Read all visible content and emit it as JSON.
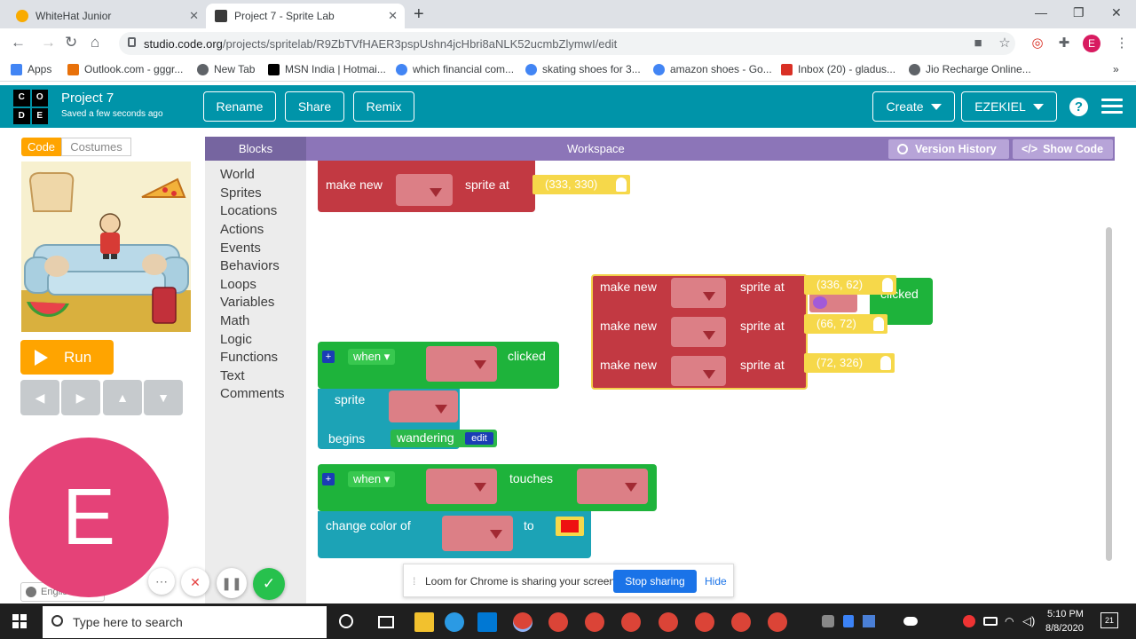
{
  "browser": {
    "tabs": [
      {
        "title": "WhiteHat Junior"
      },
      {
        "title": "Project 7 - Sprite Lab"
      }
    ],
    "url_host": "studio.code.org",
    "url_path": "/projects/spritelab/R9ZbTVfHAER3pspUshn4jcHbri8aNLK52ucmbZlymwI/edit",
    "profile_initial": "E",
    "bookmarks": [
      {
        "label": "Apps",
        "color": "#4285f4"
      },
      {
        "label": "Outlook.com - gggr...",
        "color": "#e8710a"
      },
      {
        "label": "New Tab",
        "color": "#5f6368"
      },
      {
        "label": "MSN India | Hotmai...",
        "color": "#000000"
      },
      {
        "label": "which financial com...",
        "color": "#4285f4"
      },
      {
        "label": "skating shoes for 3...",
        "color": "#4285f4"
      },
      {
        "label": "amazon shoes - Go...",
        "color": "#4285f4"
      },
      {
        "label": "Inbox (20) - gladus...",
        "color": "#d93025"
      },
      {
        "label": "Jio Recharge Online...",
        "color": "#5f6368"
      }
    ]
  },
  "app": {
    "logo_letters": [
      "C",
      "O",
      "D",
      "E"
    ],
    "project_title": "Project 7",
    "save_status": "Saved a few seconds ago",
    "rename_label": "Rename",
    "share_label": "Share",
    "remix_label": "Remix",
    "create_label": "Create",
    "user_label": "EZEKIEL",
    "help_label": "?"
  },
  "left": {
    "code_tab": "Code",
    "costumes_tab": "Costumes",
    "run_label": "Run",
    "arrows": [
      "◀",
      "▶",
      "▲",
      "▼"
    ],
    "language": "English"
  },
  "toolbox": {
    "header": "Blocks",
    "categories": [
      "World",
      "Sprites",
      "Locations",
      "Actions",
      "Events",
      "Behaviors",
      "Loops",
      "Variables",
      "Math",
      "Logic",
      "Functions",
      "Text",
      "Comments"
    ]
  },
  "workspace": {
    "header": "Workspace",
    "version_history": "Version History",
    "show_code": "Show Code",
    "blocks": {
      "make_new": "make new",
      "sprite_at": "sprite at",
      "when": "when",
      "clicked": "clicked",
      "sprite": "sprite",
      "begins": "begins",
      "wandering": "wandering",
      "edit": "edit",
      "touches": "touches",
      "change_color_of": "change color of",
      "to": "to",
      "coord_top": "(333, 330)",
      "coord_1": "(336, 62)",
      "coord_2": "(66, 72)",
      "coord_3": "(72, 326)",
      "plus": "+"
    },
    "color_swatch": "#ee1111"
  },
  "loom": {
    "avatar_letter": "E",
    "sharing_text": "Loom for Chrome is sharing your screen.",
    "stop_label": "Stop sharing",
    "hide_label": "Hide"
  },
  "taskbar": {
    "search_placeholder": "Type here to search",
    "time": "5:10 PM",
    "date": "8/8/2020",
    "notifications": "21"
  }
}
